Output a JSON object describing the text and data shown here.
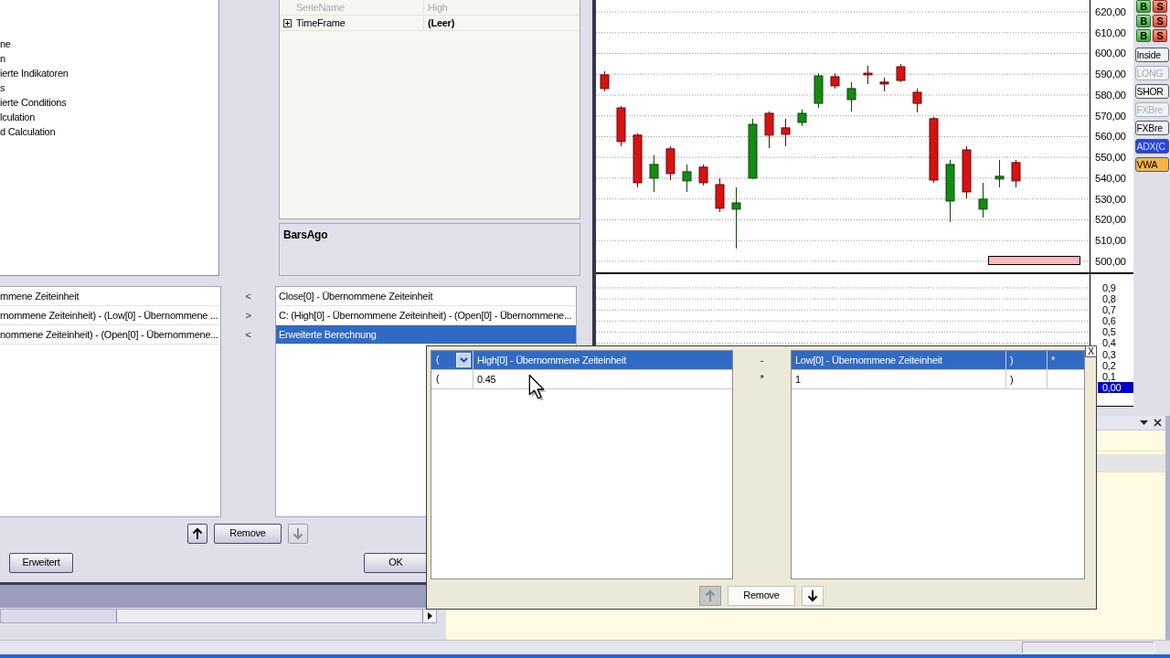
{
  "tree": {
    "items": [
      {
        "label": "ne"
      },
      {
        "label": "n"
      },
      {
        "label": "ierte Indikatoren"
      },
      {
        "label": "s"
      },
      {
        "label": "ierte Conditions"
      },
      {
        "label": "lculation"
      },
      {
        "label": "d Calculation"
      }
    ]
  },
  "property_grid": {
    "rows": [
      {
        "name": "SerieName",
        "value": "High",
        "disabled": true,
        "expandable": false
      },
      {
        "name": "TimeFrame",
        "value": "(Leer)",
        "disabled": false,
        "expandable": true
      }
    ]
  },
  "description": {
    "title": "BarsAgo"
  },
  "source_list": {
    "items": [
      {
        "label": "mmene Zeiteinheit"
      },
      {
        "label": "rnommene Zeiteinheit) - (Low[0] - Übernommene ..."
      },
      {
        "label": "nommene Zeiteinheit) - (Open[0] - Übernommene..."
      }
    ]
  },
  "transfer_arrows": [
    "<",
    ">",
    "<"
  ],
  "condition_list": {
    "items": [
      {
        "label": "Close[0] - Übernommene Zeiteinheit",
        "selected": false
      },
      {
        "label": "C: (High[0] - Übernommene Zeiteinheit) - (Open[0] - Übernommene...",
        "selected": false
      },
      {
        "label": "Erweiterte Berechnung",
        "selected": true
      }
    ]
  },
  "list_toolbar": {
    "move_up": {
      "disabled": false
    },
    "remove": "Remove",
    "move_down": {
      "disabled": true
    }
  },
  "dialog_buttons": [
    {
      "label": "Erweitert"
    },
    {
      "label": "OK"
    }
  ],
  "chart": {
    "chart_data": {
      "type": "candlestick",
      "categories": [
        null,
        null,
        null,
        null,
        null,
        null,
        null,
        null,
        null,
        null,
        null,
        null,
        null,
        null,
        null,
        null,
        null,
        null,
        null,
        null,
        null,
        null,
        null,
        null,
        null,
        null,
        null,
        null,
        null,
        null
      ],
      "ohlc": [
        [
          589.7,
          591.4,
          581.8,
          583.1
        ],
        [
          573.8,
          574.7,
          555.4,
          557.6
        ],
        [
          560.7,
          561.5,
          535.6,
          537.8
        ],
        [
          540.0,
          551.0,
          533.4,
          546.6
        ],
        [
          554.1,
          555.4,
          539.1,
          542.2
        ],
        [
          538.7,
          546.6,
          533.4,
          543.1
        ],
        [
          545.3,
          546.6,
          536.5,
          537.8
        ],
        [
          536.9,
          540.0,
          523.7,
          525.5
        ],
        [
          525.1,
          535.6,
          506.2,
          528.1
        ],
        [
          540.0,
          568.6,
          539.6,
          565.9
        ],
        [
          571.2,
          572.1,
          554.5,
          560.7
        ],
        [
          564.2,
          568.6,
          555.4,
          561.1
        ],
        [
          566.8,
          573.0,
          565.1,
          571.2
        ],
        [
          576.0,
          590.5,
          573.8,
          589.2
        ],
        [
          588.8,
          590.5,
          583.1,
          584.4
        ],
        [
          577.8,
          586.2,
          572.1,
          583.1
        ],
        [
          590.5,
          594.1,
          585.3,
          589.7
        ],
        [
          586.2,
          588.4,
          581.8,
          585.3
        ],
        [
          593.6,
          594.9,
          586.2,
          587.0
        ],
        [
          581.3,
          583.1,
          571.6,
          576.0
        ],
        [
          568.6,
          569.5,
          537.8,
          539.1
        ],
        [
          529.0,
          548.8,
          518.9,
          546.6
        ],
        [
          553.6,
          555.4,
          530.3,
          533.4
        ],
        [
          525.1,
          537.8,
          521.1,
          529.9
        ],
        [
          539.6,
          548.8,
          535.6,
          540.9
        ],
        [
          547.5,
          548.8,
          535.6,
          538.7
        ],
        null,
        null,
        null,
        null
      ],
      "ylim": [
        494.7,
        625.7
      ],
      "grid": true,
      "yticks": [
        {
          "value": 620,
          "label": "620,00"
        },
        {
          "value": 610,
          "label": "610,00"
        },
        {
          "value": 600,
          "label": "600,00"
        },
        {
          "value": 590,
          "label": "590,00"
        },
        {
          "value": 580,
          "label": "580,00"
        },
        {
          "value": 570,
          "label": "570,00"
        },
        {
          "value": 560,
          "label": "560,00"
        },
        {
          "value": 550,
          "label": "550,00"
        },
        {
          "value": 540,
          "label": "540,00"
        },
        {
          "value": 530,
          "label": "530,00"
        },
        {
          "value": 520,
          "label": "520,00"
        },
        {
          "value": 510,
          "label": "510,00"
        },
        {
          "value": 500,
          "label": "500,00"
        }
      ]
    },
    "indicator_axis": [
      "0,9",
      "0,8",
      "0,7",
      "0,6",
      "0,5",
      "0,4",
      "0,3",
      "0,2",
      "0,1"
    ],
    "indicator_current": "0,00"
  },
  "trade_buttons": [
    {
      "buy": "B",
      "sell": "S"
    },
    {
      "buy": "B",
      "sell": "S"
    },
    {
      "buy": "B",
      "sell": "S"
    }
  ],
  "strategy_buttons": [
    {
      "label": "Inside",
      "color": "#eef2f2",
      "disabled": false
    },
    {
      "label": "LONG",
      "color": "#eef2f2",
      "disabled": true
    },
    {
      "label": "SHOR",
      "color": "#eef2f2",
      "disabled": false
    },
    {
      "label": "FXBre",
      "color": "#eef2f2",
      "disabled": true
    },
    {
      "label": "FXBre",
      "color": "#eef2f2",
      "disabled": false
    },
    {
      "label": "ADX(C",
      "color": "#2b3fe6",
      "disabled": false
    },
    {
      "label": "VWA",
      "color": "#f5b448",
      "disabled": false
    }
  ],
  "docked_panel": {
    "rows": [
      {
        "selected": false
      },
      {
        "selected": true
      }
    ]
  },
  "calculation_popup": {
    "close": "X",
    "left_rows": [
      {
        "open": "(",
        "operand": "High[0] - Übernommene Zeiteinheit",
        "selected": true,
        "dropdown": true
      },
      {
        "open": "(",
        "operand": "0.45",
        "selected": false,
        "dropdown": false
      }
    ],
    "operators": [
      "-",
      "*"
    ],
    "right_rows": [
      {
        "operand": "Low[0] - Übernommene Zeiteinheit",
        "close": ")",
        "operator": "*",
        "selected": true
      },
      {
        "operand": "1",
        "close": ")",
        "selected": false
      }
    ],
    "toolbar": {
      "move_up": {
        "disabled": true
      },
      "remove": "Remove",
      "move_down": {
        "disabled": false
      }
    }
  }
}
